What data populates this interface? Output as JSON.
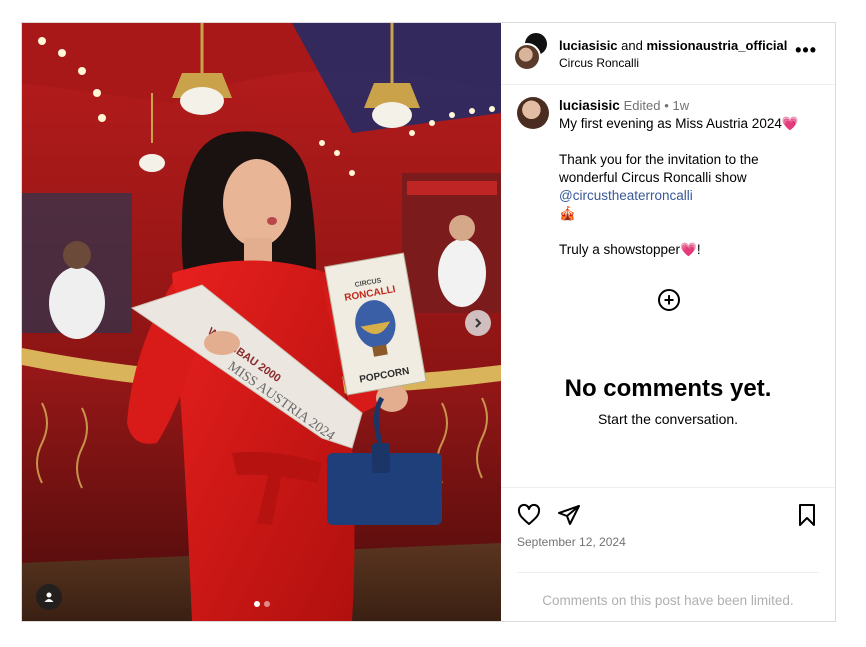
{
  "header": {
    "user1": "luciasisic",
    "joiner": "and",
    "user2": "missionaustria_official",
    "location": "Circus Roncalli",
    "more_label": "•••"
  },
  "caption": {
    "username": "luciasisic",
    "edited": "Edited",
    "separator": "•",
    "time": "1w",
    "line1": "My first evening as Miss Austria 2024💗",
    "line2": "Thank you for the invitation to the",
    "line3": "wonderful Circus Roncalli show",
    "mention": "@circustheaterroncalli",
    "emoji_line": "🎪",
    "line4": "Truly a showstopper💗!"
  },
  "comments": {
    "add_icon": "plus-circle-icon",
    "empty_title": "No comments yet.",
    "empty_subtitle": "Start the conversation."
  },
  "actions": {
    "icons": [
      "heart-icon",
      "share-icon",
      "bookmark-icon"
    ],
    "date": "September 12, 2024",
    "limited": "Comments on this post have been limited."
  },
  "media": {
    "sash_text": "MISS AUSTRIA 2024",
    "sponsor_text": "WOHNBAU 2000",
    "book_title": "RONCALLI",
    "book_sub": "CIRCUS",
    "book_bottom": "POPCORN",
    "carousel_count": 2,
    "carousel_active": 1
  }
}
